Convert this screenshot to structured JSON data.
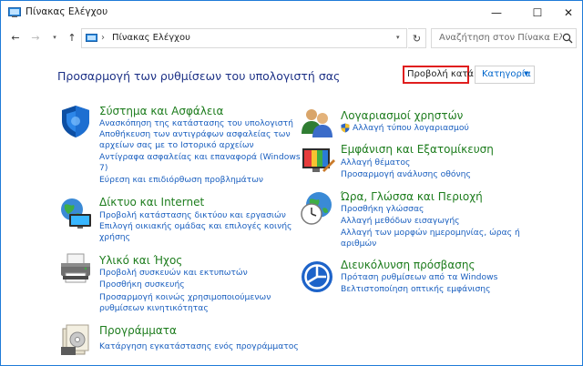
{
  "window": {
    "title": "Πίνακας Ελέγχου",
    "controls": {
      "minimize": "—",
      "maximize": "☐",
      "close": "✕"
    }
  },
  "nav": {
    "back": "←",
    "forward": "→",
    "recent": "▾",
    "up": "↑",
    "breadcrumb_sep": "›",
    "address": "Πίνακας Ελέγχου",
    "address_dropdown": "▾",
    "refresh": "↻",
    "search_placeholder": "Αναζήτηση στον Πίνακα Ελέγ..."
  },
  "header": {
    "heading": "Προσαρμογή των ρυθμίσεων του υπολογιστή σας",
    "view_by_label": "Προβολή κατά:",
    "view_by_value": "Κατηγορία",
    "view_by_caret": "▼"
  },
  "categories": {
    "system": {
      "title": "Σύστημα και Ασφάλεια",
      "links": [
        "Ανασκόπηση της κατάστασης του υπολογιστή",
        "Αποθήκευση των αντιγράφων ασφαλείας των",
        "αρχείων σας με το Ιστορικό αρχείων",
        "Αντίγραφα ασφαλείας και επαναφορά (Windows",
        "7)",
        "Εύρεση και επιδιόρθωση προβλημάτων"
      ]
    },
    "network": {
      "title": "Δίκτυο και Internet",
      "links": [
        "Προβολή κατάστασης δικτύου και εργασιών",
        "Επιλογή οικιακής ομάδας και επιλογές κοινής",
        "χρήσης"
      ]
    },
    "hardware": {
      "title": "Υλικό και Ήχος",
      "links": [
        "Προβολή συσκευών και εκτυπωτών",
        "Προσθήκη συσκευής",
        "Προσαρμογή κοινώς χρησιμοποιούμενων",
        "ρυθμίσεων κινητικότητας"
      ]
    },
    "programs": {
      "title": "Προγράμματα",
      "links": [
        "Κατάργηση εγκατάστασης ενός προγράμματος"
      ]
    },
    "accounts": {
      "title": "Λογαριασμοί χρηστών",
      "links": [
        "Αλλαγή τύπου λογαριασμού"
      ]
    },
    "appearance": {
      "title": "Εμφάνιση και Εξατομίκευση",
      "links": [
        "Αλλαγή θέματος",
        "Προσαρμογή ανάλυσης οθόνης"
      ]
    },
    "clock": {
      "title": "Ώρα, Γλώσσα και Περιοχή",
      "links": [
        "Προσθήκη γλώσσας",
        "Αλλαγή μεθόδων εισαγωγής",
        "Αλλαγή των μορφών ημερομηνίας, ώρας ή",
        "αριθμών"
      ]
    },
    "ease": {
      "title": "Διευκόλυνση πρόσβασης",
      "links": [
        "Πρόταση ρυθμίσεων από τα Windows",
        "Βελτιστοποίηση οπτικής εμφάνισης"
      ]
    }
  },
  "colors": {
    "accent": "#1f7bd8",
    "category_title": "#1e7d1e",
    "link": "#1a5fbf",
    "heading": "#1e3287",
    "highlight_box": "#e01e1e"
  }
}
